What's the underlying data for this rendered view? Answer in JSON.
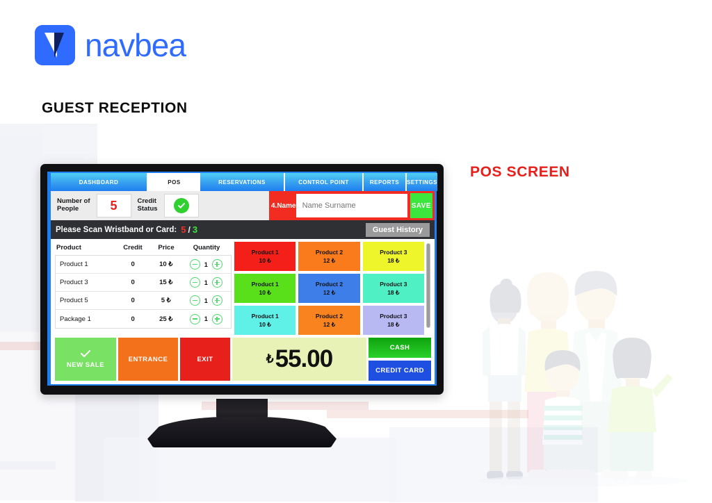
{
  "brand": {
    "name": "navbea",
    "logo_icon": "navbea-arrow-logo",
    "color": "#2f6bff"
  },
  "page": {
    "section_title": "GUEST RECEPTION",
    "callout_label": "POS SCREEN",
    "callout_color": "#e8201c",
    "illustration": "family-illustration"
  },
  "pos": {
    "tabs": [
      {
        "label": "DASHBOARD",
        "active": false
      },
      {
        "label": "POS",
        "active": true
      },
      {
        "label": "RESERVATIONS",
        "active": false
      },
      {
        "label": "CONTROL POINT",
        "active": false
      },
      {
        "label": "REPORTS",
        "active": false
      },
      {
        "label": "SETTINGS",
        "active": false
      }
    ],
    "top_row": {
      "people_label": "Number of\nPeople",
      "people_label_line1": "Number of",
      "people_label_line2": "People",
      "people_value": "5",
      "credit_label_line1": "Credit",
      "credit_label_line2": "Status",
      "credit_status_icon": "check-circle-icon",
      "credit_status_color": "#2fd02f",
      "name_tag": "4.Name",
      "name_placeholder": "Name Surname",
      "name_value": "",
      "save_label": "SAVE"
    },
    "scan_bar": {
      "message": "Please Scan Wristband or Card:",
      "count_scanned": "5",
      "separator": "/",
      "count_remaining": "3",
      "count_scanned_color": "#f0322a",
      "count_remaining_color": "#3ce63c",
      "guest_history_label": "Guest History"
    },
    "cart": {
      "columns": [
        "Product",
        "Credit",
        "Price",
        "Quantity"
      ],
      "currency_symbol": "₺",
      "rows": [
        {
          "product": "Product 1",
          "credit": "0",
          "price": "10",
          "quantity": "1"
        },
        {
          "product": "Product 3",
          "credit": "0",
          "price": "15",
          "quantity": "1"
        },
        {
          "product": "Product 5",
          "credit": "0",
          "price": "5",
          "quantity": "1"
        },
        {
          "product": "Package 1",
          "credit": "0",
          "price": "25",
          "quantity": "1"
        }
      ],
      "decrement_icon": "minus-circle-icon",
      "increment_icon": "plus-circle-icon"
    },
    "tiles": [
      {
        "name": "Product 1",
        "price": "10 ₺",
        "color": "#f41f18"
      },
      {
        "name": "Product 2",
        "price": "12 ₺",
        "color": "#f97b1c"
      },
      {
        "name": "Product 3",
        "price": "18 ₺",
        "color": "#eef52b"
      },
      {
        "name": "Product 1",
        "price": "10 ₺",
        "color": "#5ae01a"
      },
      {
        "name": "Product 2",
        "price": "12 ₺",
        "color": "#3d7ee8"
      },
      {
        "name": "Product 3",
        "price": "18 ₺",
        "color": "#4ef0c4"
      },
      {
        "name": "Product 1",
        "price": "10 ₺",
        "color": "#5ff0e8"
      },
      {
        "name": "Product 2",
        "price": "12 ₺",
        "color": "#f9841f"
      },
      {
        "name": "Product 3",
        "price": "18 ₺",
        "color": "#b8b8f2"
      }
    ],
    "actions": {
      "new_sale_label": "NEW SALE",
      "new_sale_icon": "check-icon",
      "entrance_label": "ENTRANCE",
      "exit_label": "EXIT"
    },
    "total": {
      "currency_symbol": "₺",
      "amount": "55.00"
    },
    "payment": {
      "cash_label": "CASH",
      "credit_card_label": "CREDIT CARD"
    }
  }
}
